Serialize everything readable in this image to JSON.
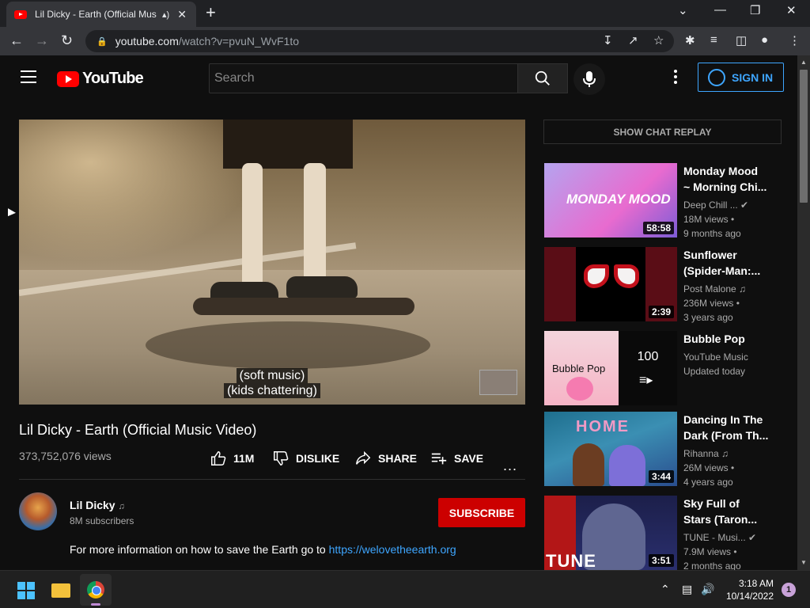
{
  "browser": {
    "tab_title": "Lil Dicky - Earth (Official Mus",
    "url_host": "youtube.com",
    "url_path": "/watch?v=pvuN_WvF1to"
  },
  "header": {
    "logo_text": "YouTube",
    "search_placeholder": "Search",
    "signin_label": "SIGN IN"
  },
  "player": {
    "captions": [
      "(soft music)",
      "(kids chattering)"
    ]
  },
  "video": {
    "title": "Lil Dicky - Earth (Official Music Video)",
    "views": "373,752,076 views",
    "like_count": "11M",
    "dislike_label": "DISLIKE",
    "share_label": "SHARE",
    "save_label": "SAVE",
    "more_label": "..."
  },
  "channel": {
    "name": "Lil Dicky",
    "subscribers": "8M subscribers",
    "subscribe_label": "SUBSCRIBE"
  },
  "description": {
    "text": "For more information on how to save the Earth go to",
    "link": "https://welovetheearth.org"
  },
  "sidebar": {
    "chat_replay_label": "SHOW CHAT REPLAY",
    "recommendations": [
      {
        "title_line1": "Monday Mood",
        "title_line2": "~ Morning Chi...",
        "channel": "Deep Chill ...",
        "views": "18M views •",
        "age": "9 months ago",
        "duration": "58:58",
        "thumb_text": "MONDAY MOOD"
      },
      {
        "title_line1": "Sunflower",
        "title_line2": "(Spider-Man:...",
        "channel": "Post Malone",
        "views": "236M views •",
        "age": "3 years ago",
        "duration": "2:39"
      },
      {
        "title_line1": "Bubble Pop",
        "title_line2": "",
        "channel": "YouTube Music",
        "views": "Updated today",
        "age": "",
        "playlist_count": "100",
        "thumb_text": "Bubble Pop"
      },
      {
        "title_line1": "Dancing In The",
        "title_line2": "Dark (From Th...",
        "channel": "Rihanna",
        "views": "26M views •",
        "age": "4 years ago",
        "duration": "3:44",
        "thumb_text": "HOME"
      },
      {
        "title_line1": "Sky Full of",
        "title_line2": "Stars (Taron...",
        "channel": "TUNE - Musi...",
        "views": "7.9M views •",
        "age": "2 months ago",
        "duration": "3:51",
        "thumb_text": "TUNE"
      }
    ]
  },
  "taskbar": {
    "time": "3:18 AM",
    "date": "10/14/2022",
    "notification_count": "1"
  },
  "colors": {
    "youtube_red": "#ff0000",
    "link_blue": "#3ea6ff",
    "subscribe_red": "#cc0000"
  }
}
